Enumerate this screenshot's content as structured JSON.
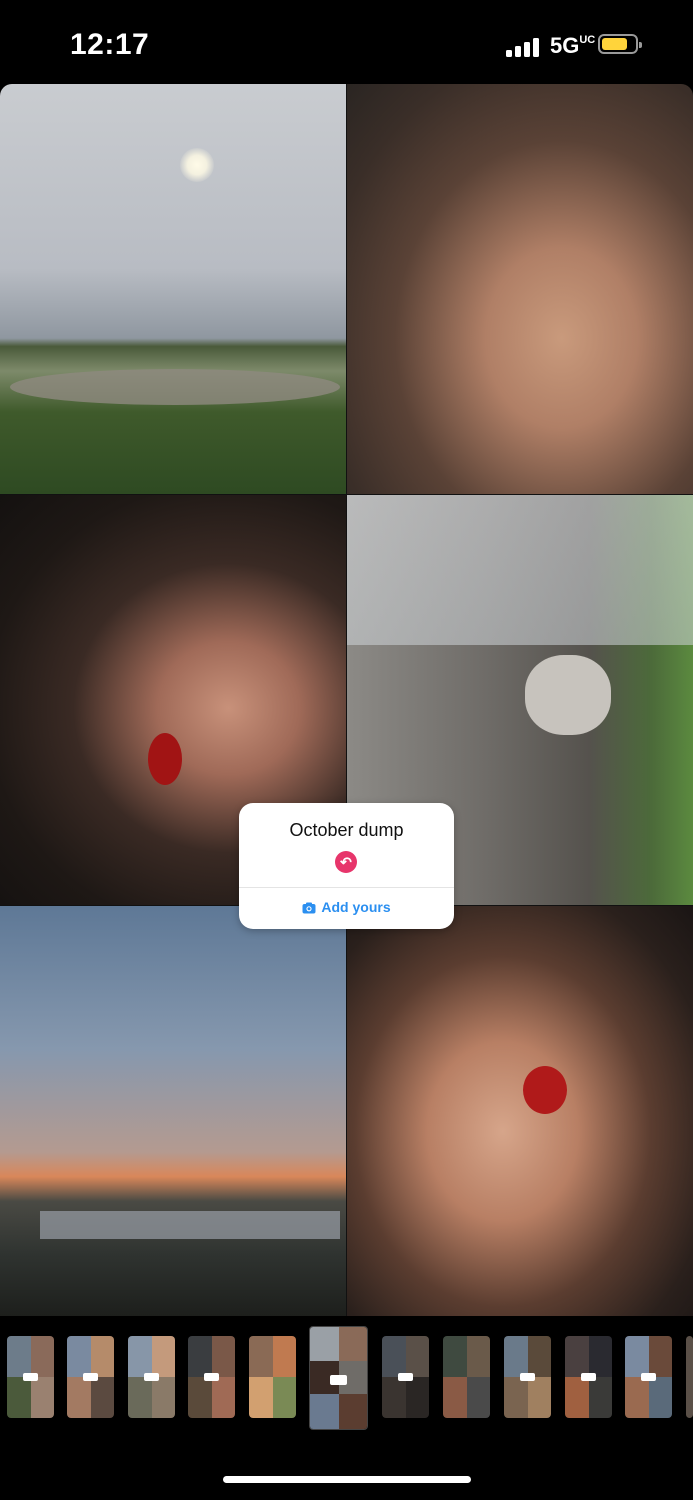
{
  "status_bar": {
    "time": "12:17",
    "network": "5G",
    "network_sup": "UC",
    "battery_color": "#ffd43b"
  },
  "story": {
    "tiles": [
      {
        "name": "photo-sky-pond"
      },
      {
        "name": "photo-freckled-selfie"
      },
      {
        "name": "photo-red-lips-selfie"
      },
      {
        "name": "photo-kitten-on-logs"
      },
      {
        "name": "photo-sunset-lake"
      },
      {
        "name": "photo-upside-down-selfie"
      }
    ]
  },
  "sticker": {
    "title": "October dump",
    "badge_icon": "reply-arrow-icon",
    "action_label": "Add yours",
    "action_icon": "camera-icon",
    "accent_color": "#e7356b",
    "link_color": "#2b8ff0"
  },
  "thumbnails": {
    "count": 12,
    "active_index": 5
  }
}
